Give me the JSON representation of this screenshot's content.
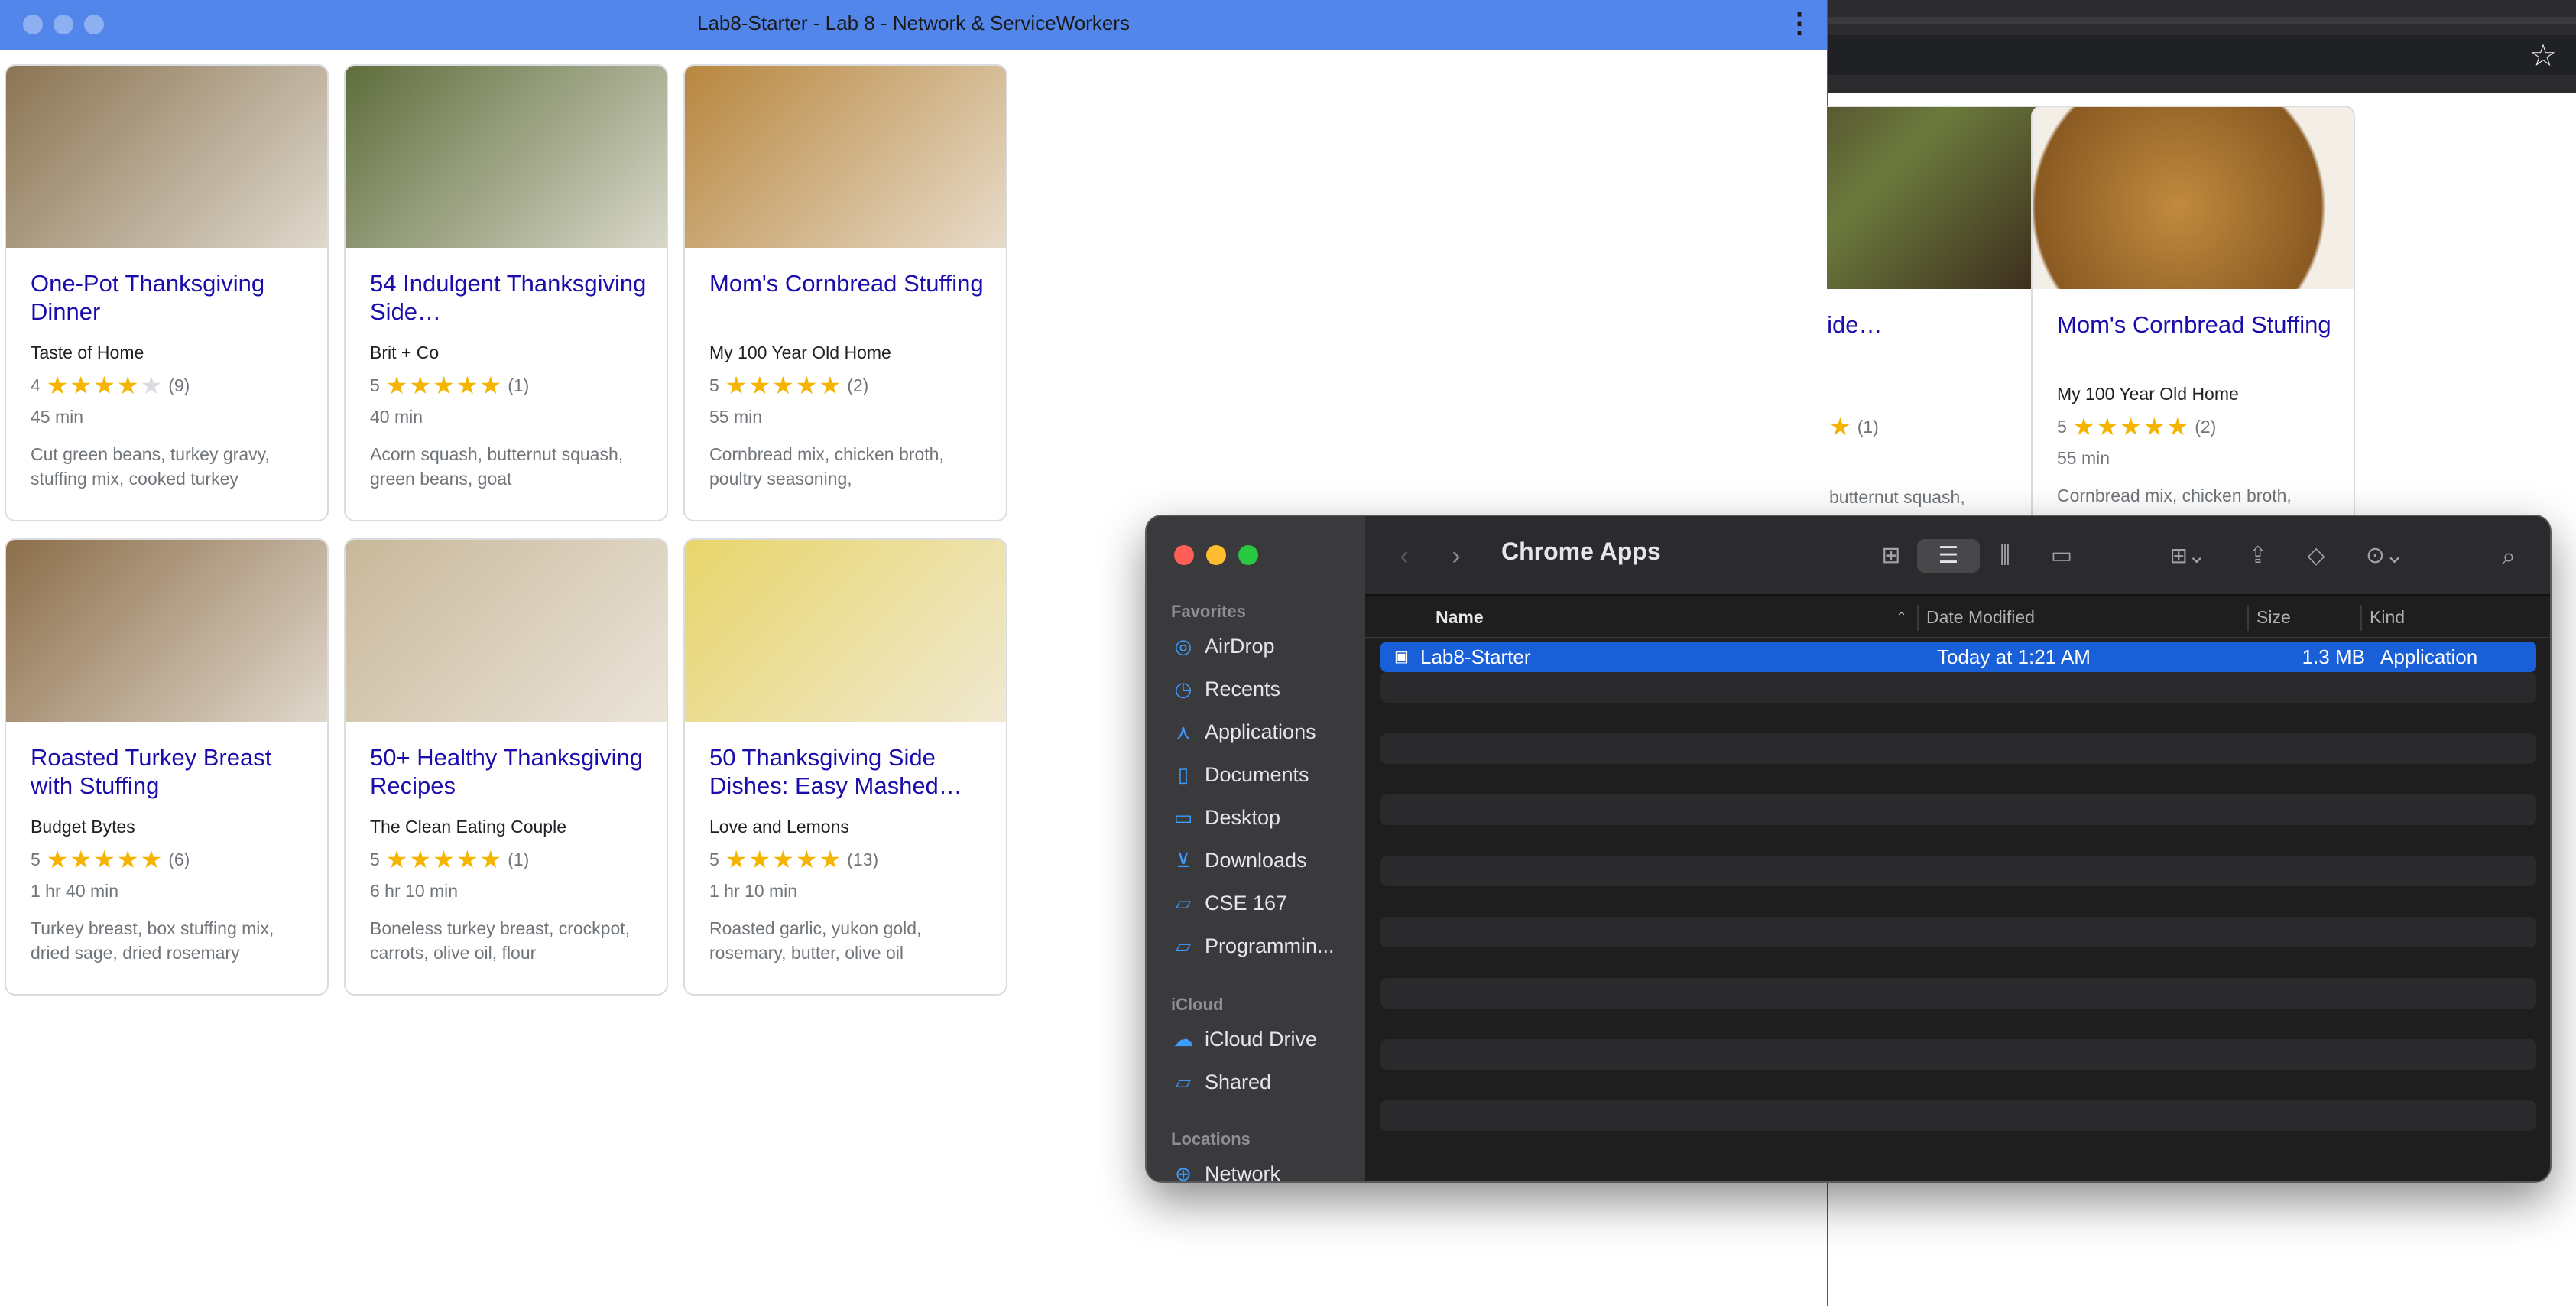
{
  "app": {
    "title": "Lab8-Starter - Lab 8 - Network & ServiceWorkers"
  },
  "cards": [
    {
      "title": "One-Pot Thanksgiving Dinner",
      "source": "Taste of Home",
      "rating": "4",
      "stars": 4,
      "reviews": "(9)",
      "time": "45 min",
      "ingredients": "Cut green beans, turkey gravy, stuffing mix, cooked turkey",
      "img_color": "#8a7452"
    },
    {
      "title": "54 Indulgent Thanksgiving Side…",
      "source": "Brit + Co",
      "rating": "5",
      "stars": 5,
      "reviews": "(1)",
      "time": "40 min",
      "ingredients": "Acorn squash, butternut squash, green beans, goat",
      "img_color": "#5f6e3c"
    },
    {
      "title": "Mom's Cornbread Stuffing",
      "source": "My 100 Year Old Home",
      "rating": "5",
      "stars": 5,
      "reviews": "(2)",
      "time": "55 min",
      "ingredients": "Cornbread mix, chicken broth, poultry seasoning,",
      "img_color": "#b8863e"
    },
    {
      "title": "Roasted Turkey Breast with Stuffing",
      "source": "Budget Bytes",
      "rating": "5",
      "stars": 5,
      "reviews": "(6)",
      "time": "1 hr 40 min",
      "ingredients": "Turkey breast, box stuffing mix, dried sage, dried rosemary",
      "img_color": "#8c6e4a"
    },
    {
      "title": "50+ Healthy Thanksgiving Recipes",
      "source": "The Clean Eating Couple",
      "rating": "5",
      "stars": 5,
      "reviews": "(1)",
      "time": "6 hr 10 min",
      "ingredients": "Boneless turkey breast, crockpot, carrots, olive oil, flour",
      "img_color": "#c8b89a"
    },
    {
      "title": "50 Thanksgiving Side Dishes: Easy Mashed…",
      "source": "Love and Lemons",
      "rating": "5",
      "stars": 5,
      "reviews": "(13)",
      "time": "1 hr 10 min",
      "ingredients": "Roasted garlic, yukon gold, rosemary, butter, olive oil",
      "img_color": "#e8d56a"
    }
  ],
  "bg_window": {
    "cards": [
      {
        "title": "nt ing Side…",
        "reviews": "(1)",
        "ingredients": "butternut squash,"
      },
      {
        "title": "Mom's Cornbread Stuffing",
        "source": "My 100 Year Old Home",
        "rating": "5",
        "reviews": "(2)",
        "time": "55 min",
        "ingredients": "Cornbread mix, chicken broth,"
      }
    ]
  },
  "finder": {
    "title": "Chrome Apps",
    "sidebar": {
      "favorites_header": "Favorites",
      "favorites": [
        {
          "label": "AirDrop",
          "icon": "airdrop-icon",
          "glyph": "◎"
        },
        {
          "label": "Recents",
          "icon": "clock-icon",
          "glyph": "◷"
        },
        {
          "label": "Applications",
          "icon": "applications-icon",
          "glyph": "⋏"
        },
        {
          "label": "Documents",
          "icon": "document-icon",
          "glyph": "▯"
        },
        {
          "label": "Desktop",
          "icon": "desktop-icon",
          "glyph": "▭"
        },
        {
          "label": "Downloads",
          "icon": "download-icon",
          "glyph": "⊻"
        },
        {
          "label": "CSE 167",
          "icon": "folder-icon",
          "glyph": "▱"
        },
        {
          "label": "Programmin...",
          "icon": "folder-icon",
          "glyph": "▱"
        }
      ],
      "icloud_header": "iCloud",
      "icloud": [
        {
          "label": "iCloud Drive",
          "icon": "cloud-icon",
          "glyph": "☁"
        },
        {
          "label": "Shared",
          "icon": "shared-folder-icon",
          "glyph": "▱"
        }
      ],
      "locations_header": "Locations",
      "locations": [
        {
          "label": "Network",
          "icon": "network-icon",
          "glyph": "⊕"
        }
      ]
    },
    "columns": {
      "name": "Name",
      "date": "Date Modified",
      "size": "Size",
      "kind": "Kind"
    },
    "files": [
      {
        "name": "Lab8-Starter",
        "date": "Today at 1:21 AM",
        "size": "1.3 MB",
        "kind": "Application"
      }
    ]
  },
  "colors": {
    "app_titlebar": "#5286ea",
    "link": "#1a0dab",
    "star": "#f4b400",
    "selection": "#1960d8"
  }
}
